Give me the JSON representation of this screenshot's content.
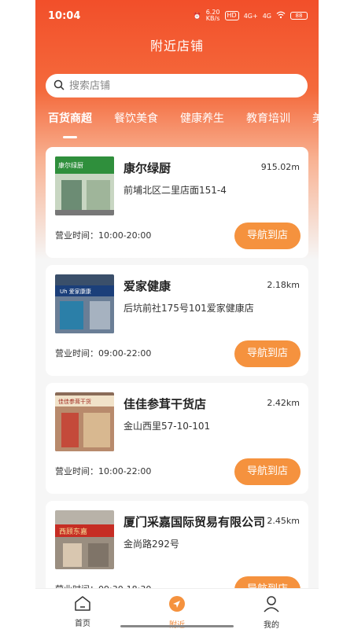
{
  "status": {
    "time": "10:04",
    "net_speed": "6.20\nKB/s",
    "hd": "HD",
    "sig1": "4G+",
    "sig2": "4G",
    "battery": "88"
  },
  "header": {
    "title": "附近店铺"
  },
  "search": {
    "placeholder": "搜索店铺"
  },
  "tabs": [
    {
      "label": "百货商超",
      "active": true
    },
    {
      "label": "餐饮美食"
    },
    {
      "label": "健康养生"
    },
    {
      "label": "教育培训"
    },
    {
      "label": "美"
    }
  ],
  "stores": [
    {
      "name": "康尔绿厨",
      "distance": "915.02m",
      "address": "前埔北区二里店面151-4",
      "hours": "营业时间：10:00-20:00",
      "nav_label": "导航到店",
      "thumb_sign": "康尔绿厨"
    },
    {
      "name": "爱家健康",
      "distance": "2.18km",
      "address": "后坑前社175号101爱家健康店",
      "hours": "营业时间：09:00-22:00",
      "nav_label": "导航到店",
      "thumb_sign": "Uh 爱家康康"
    },
    {
      "name": "佳佳参茸干货店",
      "distance": "2.42km",
      "address": "金山西里57-10-101",
      "hours": "营业时间：10:00-22:00",
      "nav_label": "导航到店",
      "thumb_sign": "佳佳参茸干货"
    },
    {
      "name": "厦门采嘉国际贸易有限公司",
      "distance": "2.45km",
      "address": "金尚路292号",
      "hours": "营业时间：09:30-18:30",
      "nav_label": "导航到店",
      "thumb_sign": "西顾东嘉"
    }
  ],
  "tabbar": [
    {
      "label": "首页",
      "icon": "home-icon"
    },
    {
      "label": "附近",
      "icon": "compass-icon",
      "active": true
    },
    {
      "label": "我的",
      "icon": "user-icon"
    }
  ],
  "colors": {
    "accent": "#f24f2a",
    "button": "#f5923e"
  }
}
